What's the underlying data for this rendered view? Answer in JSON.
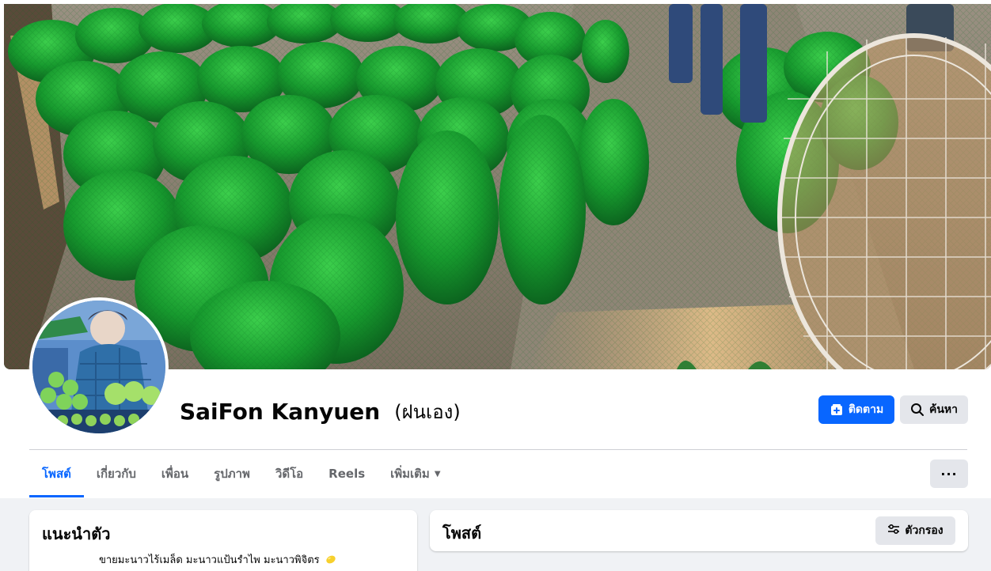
{
  "profile": {
    "name": "SaiFon Kanyuen",
    "alternate_name": "(ฝนเอง)",
    "follow_label": "ติดตาม",
    "search_label": "ค้นหา"
  },
  "tabs": [
    {
      "label": "โพสต์",
      "active": true
    },
    {
      "label": "เกี่ยวกับ",
      "active": false
    },
    {
      "label": "เพื่อน",
      "active": false
    },
    {
      "label": "รูปภาพ",
      "active": false
    },
    {
      "label": "วิดีโอ",
      "active": false
    },
    {
      "label": "Reels",
      "active": false
    },
    {
      "label": "เพิ่มเติม",
      "active": false
    }
  ],
  "more_options_label": "···",
  "intro": {
    "title": "แนะนำตัว",
    "bio": "ขายมะนาวไร้เมล็ด มะนาวแป้นรำไพ มะนาวพิจิตร"
  },
  "posts": {
    "title": "โพสต์",
    "filter_label": "ตัวกรอง"
  },
  "colors": {
    "accent": "#0866ff",
    "secondary_button": "#e4e6eb",
    "page_background": "#f0f2f5"
  },
  "icons": {
    "follow": "follow-icon",
    "search": "search-icon",
    "more": "more-options-icon",
    "filter": "filter-icon",
    "dropdown": "chevron-down-icon",
    "bio_emoji": "lemon-emoji"
  }
}
